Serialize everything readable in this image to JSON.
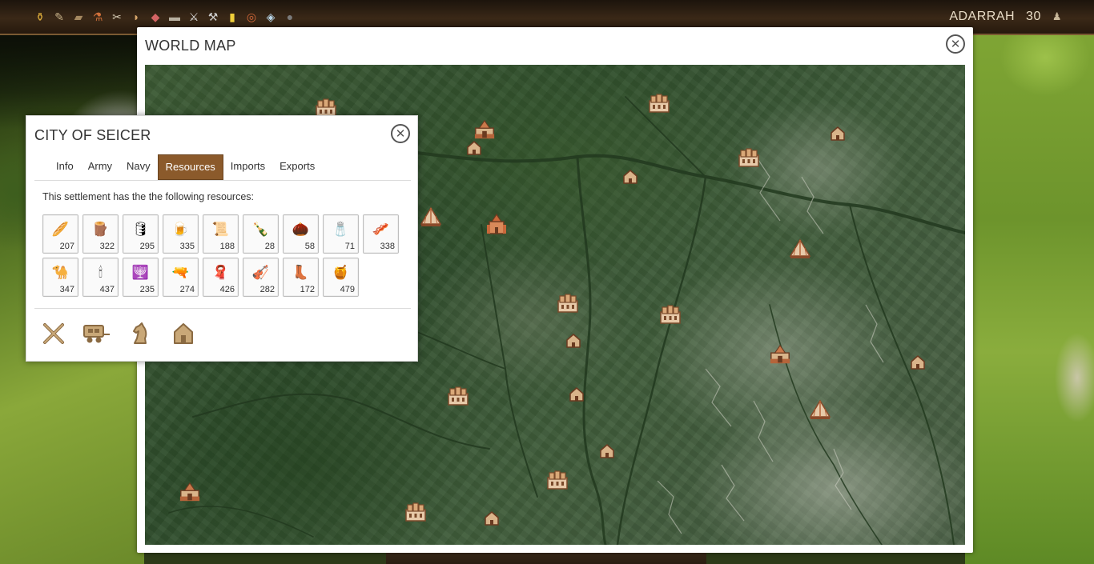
{
  "topbar": {
    "resource_icons": [
      {
        "name": "gold-icon",
        "glyph": "⚱",
        "color": "#e3b23c"
      },
      {
        "name": "tools-icon",
        "glyph": "✎",
        "color": "#c9b48a"
      },
      {
        "name": "stone-icon",
        "glyph": "▰",
        "color": "#a48860"
      },
      {
        "name": "pottery-icon",
        "glyph": "⚗",
        "color": "#d0703a"
      },
      {
        "name": "crossed-tools-icon",
        "glyph": "✂",
        "color": "#d8cfb8"
      },
      {
        "name": "bread-icon",
        "glyph": "◗",
        "color": "#d9a86c"
      },
      {
        "name": "meat-icon",
        "glyph": "◆",
        "color": "#d46464"
      },
      {
        "name": "cloth-icon",
        "glyph": "▬",
        "color": "#b8b0a0"
      },
      {
        "name": "swords-icon",
        "glyph": "⚔",
        "color": "#e0e0e0"
      },
      {
        "name": "hammer-icon",
        "glyph": "⚒",
        "color": "#cfcfcf"
      },
      {
        "name": "gold-bar-icon",
        "glyph": "▮",
        "color": "#f0cf3a"
      },
      {
        "name": "rope-icon",
        "glyph": "◎",
        "color": "#d86a3a"
      },
      {
        "name": "crystal-icon",
        "glyph": "◈",
        "color": "#b9d6e8"
      },
      {
        "name": "ore-icon",
        "glyph": "●",
        "color": "#7a7a7a"
      }
    ],
    "player_name": "ADARRAH",
    "player_level": "30",
    "player_icon": "user-icon"
  },
  "world_map": {
    "title": "WORLD MAP",
    "close_icon": "close-icon",
    "markers": [
      {
        "type": "city",
        "name": "map-city-marker"
      },
      {
        "type": "castle",
        "name": "map-castle-marker"
      },
      {
        "type": "house",
        "name": "map-house-marker"
      },
      {
        "type": "city",
        "name": "map-city-marker"
      },
      {
        "type": "house",
        "name": "map-house-marker"
      },
      {
        "type": "house",
        "name": "map-house-marker"
      },
      {
        "type": "city",
        "name": "map-city-marker"
      },
      {
        "type": "tent",
        "name": "map-tent-marker"
      },
      {
        "type": "temple",
        "name": "map-temple-marker"
      },
      {
        "type": "tent",
        "name": "map-tent-marker"
      },
      {
        "type": "city",
        "name": "map-city-marker"
      },
      {
        "type": "city",
        "name": "map-city-marker"
      },
      {
        "type": "house",
        "name": "map-house-marker"
      },
      {
        "type": "castle",
        "name": "map-castle-marker"
      },
      {
        "type": "house",
        "name": "map-house-marker"
      },
      {
        "type": "city",
        "name": "map-city-marker"
      },
      {
        "type": "house",
        "name": "map-house-marker"
      },
      {
        "type": "tent",
        "name": "map-tent-marker"
      },
      {
        "type": "house",
        "name": "map-house-marker"
      },
      {
        "type": "city",
        "name": "map-city-marker"
      },
      {
        "type": "castle",
        "name": "map-castle-marker"
      },
      {
        "type": "city",
        "name": "map-city-marker"
      },
      {
        "type": "house",
        "name": "map-house-marker"
      }
    ]
  },
  "city_panel": {
    "title": "CITY OF SEICER",
    "close_icon": "close-icon",
    "tabs": [
      "Info",
      "Army",
      "Navy",
      "Resources",
      "Imports",
      "Exports"
    ],
    "active_tab": "Resources",
    "description": "This settlement has the the following resources:",
    "resources": [
      {
        "icon": "bread-icon",
        "glyph": "🥖",
        "amount": "207"
      },
      {
        "icon": "wood-icon",
        "glyph": "🪵",
        "amount": "322"
      },
      {
        "icon": "barrel-icon",
        "glyph": "🛢",
        "amount": "295"
      },
      {
        "icon": "beer-icon",
        "glyph": "🍺",
        "amount": "335"
      },
      {
        "icon": "scroll-icon",
        "glyph": "📜",
        "amount": "188"
      },
      {
        "icon": "bottle-icon",
        "glyph": "🍾",
        "amount": "28"
      },
      {
        "icon": "seed-icon",
        "glyph": "🌰",
        "amount": "58"
      },
      {
        "icon": "salt-icon",
        "glyph": "🧂",
        "amount": "71"
      },
      {
        "icon": "sausage-icon",
        "glyph": "🥓",
        "amount": "338"
      },
      {
        "icon": "camel-icon",
        "glyph": "🐪",
        "amount": "347"
      },
      {
        "icon": "candle-icon",
        "glyph": "🕯",
        "amount": "437"
      },
      {
        "icon": "candelabra-icon",
        "glyph": "🕎",
        "amount": "235"
      },
      {
        "icon": "cannon-icon",
        "glyph": "🔫",
        "amount": "274"
      },
      {
        "icon": "silk-icon",
        "glyph": "🧣",
        "amount": "426"
      },
      {
        "icon": "harp-icon",
        "glyph": "🎻",
        "amount": "282"
      },
      {
        "icon": "boot-icon",
        "glyph": "👢",
        "amount": "172"
      },
      {
        "icon": "honey-icon",
        "glyph": "🍯",
        "amount": "479"
      }
    ],
    "actions": [
      {
        "name": "attack-button",
        "icon": "crossed-swords-icon"
      },
      {
        "name": "caravan-button",
        "icon": "caravan-icon"
      },
      {
        "name": "spy-button",
        "icon": "chess-knight-icon"
      },
      {
        "name": "settlement-button",
        "icon": "house-icon"
      }
    ]
  }
}
